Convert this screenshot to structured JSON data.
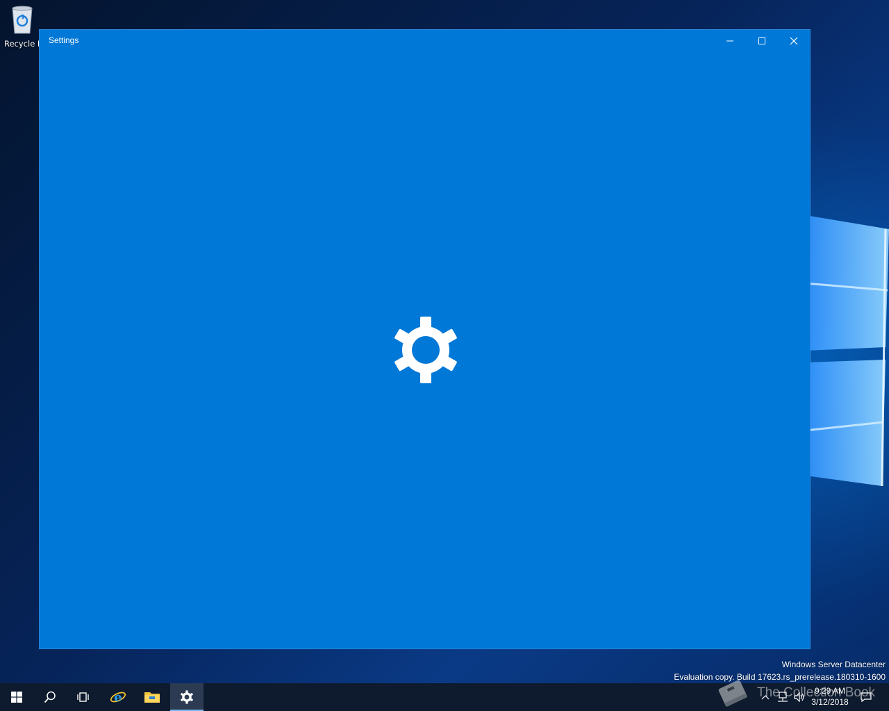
{
  "desktop": {
    "icons": [
      {
        "label": "Recycle B",
        "icon": "recycle-bin-icon"
      }
    ],
    "watermark": {
      "line1": "Windows Server Datacenter",
      "line2": "Evaluation copy. Build 17623.rs_prerelease.180310-1600"
    },
    "overlay_watermark": "The Collection Book"
  },
  "window": {
    "title": "Settings",
    "background": "#0078d7",
    "controls": {
      "minimize": "minimize-icon",
      "maximize": "maximize-icon",
      "close": "close-icon"
    },
    "splash_icon": "gear-icon"
  },
  "taskbar": {
    "background": "#0e1b2e",
    "buttons": [
      {
        "name": "start",
        "icon": "windows-logo-icon"
      },
      {
        "name": "search",
        "icon": "search-icon"
      },
      {
        "name": "task-view",
        "icon": "task-view-icon"
      },
      {
        "name": "internet-explorer",
        "icon": "internet-explorer-icon"
      },
      {
        "name": "file-explorer",
        "icon": "folder-icon"
      },
      {
        "name": "settings",
        "icon": "gear-icon",
        "active": true
      }
    ],
    "tray": {
      "icons": [
        "chevron-up-icon",
        "network-icon",
        "volume-icon",
        "action-center-icon"
      ],
      "time": "9:29 AM",
      "date": "3/12/2018"
    }
  }
}
